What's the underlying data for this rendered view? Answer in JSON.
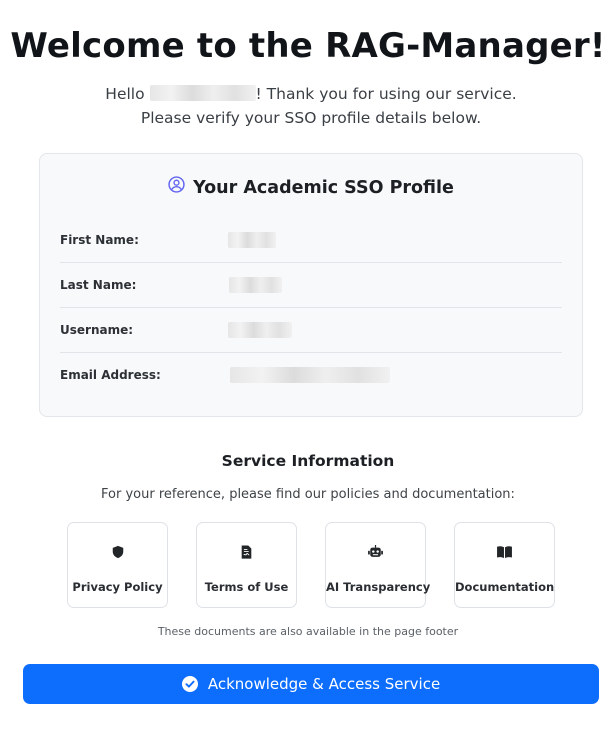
{
  "header": {
    "title": "Welcome to the RAG-Manager!",
    "intro_before": "Hello",
    "intro_after": "! Thank you for using our service. Please verify your SSO profile details below."
  },
  "profile": {
    "title": "Your Academic SSO Profile",
    "icon": "user-circle-icon",
    "fields": [
      {
        "label": "First Name:"
      },
      {
        "label": "Last Name:"
      },
      {
        "label": "Username:"
      },
      {
        "label": "Email Address:"
      }
    ]
  },
  "service": {
    "title": "Service Information",
    "subtitle": "For your reference, please find our policies and documentation:",
    "links": [
      {
        "label": "Privacy Policy",
        "icon": "shield-icon"
      },
      {
        "label": "Terms of Use",
        "icon": "document-contract-icon"
      },
      {
        "label": "AI Transparency",
        "icon": "robot-icon"
      },
      {
        "label": "Documentation",
        "icon": "book-open-icon"
      }
    ],
    "note": "These documents are also available in the page footer"
  },
  "action": {
    "label": "Acknowledge & Access Service",
    "icon": "check-circle-icon"
  },
  "colors": {
    "primary": "#0d6efd",
    "icon_accent": "#6366f1",
    "card_bg": "#f8f9fb"
  }
}
